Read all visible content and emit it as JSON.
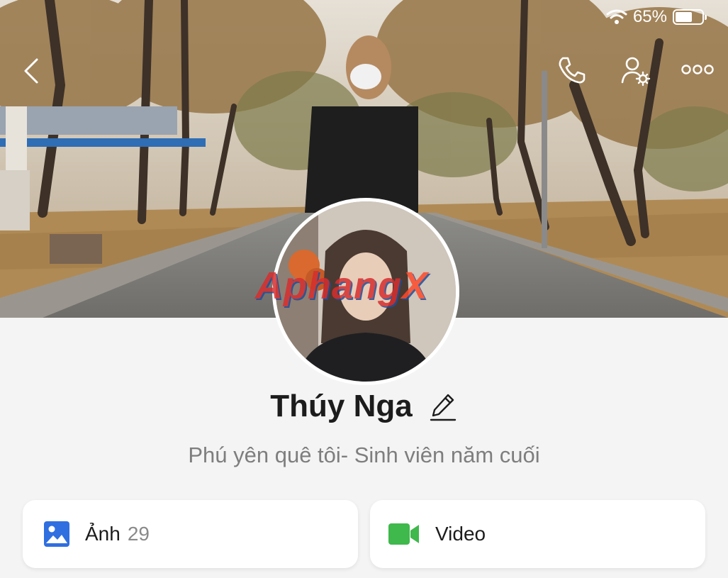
{
  "status_bar": {
    "battery_text": "65%",
    "battery_level": 0.65
  },
  "header": {
    "back_icon": "chevron-left-icon",
    "call_icon": "phone-icon",
    "settings_icon": "user-gear-icon",
    "more_icon": "more-dots-icon"
  },
  "watermark": {
    "main": "Aphang",
    "tail": "X"
  },
  "profile": {
    "name": "Thúy Nga",
    "bio": "Phú yên quê tôi- Sinh viên năm cuối"
  },
  "cards": {
    "photos": {
      "label": "Ảnh",
      "count": "29",
      "icon": "image-icon",
      "color": "#2f6fe0"
    },
    "video": {
      "label": "Video",
      "icon": "video-camera-icon",
      "color": "#3fb84c"
    }
  }
}
